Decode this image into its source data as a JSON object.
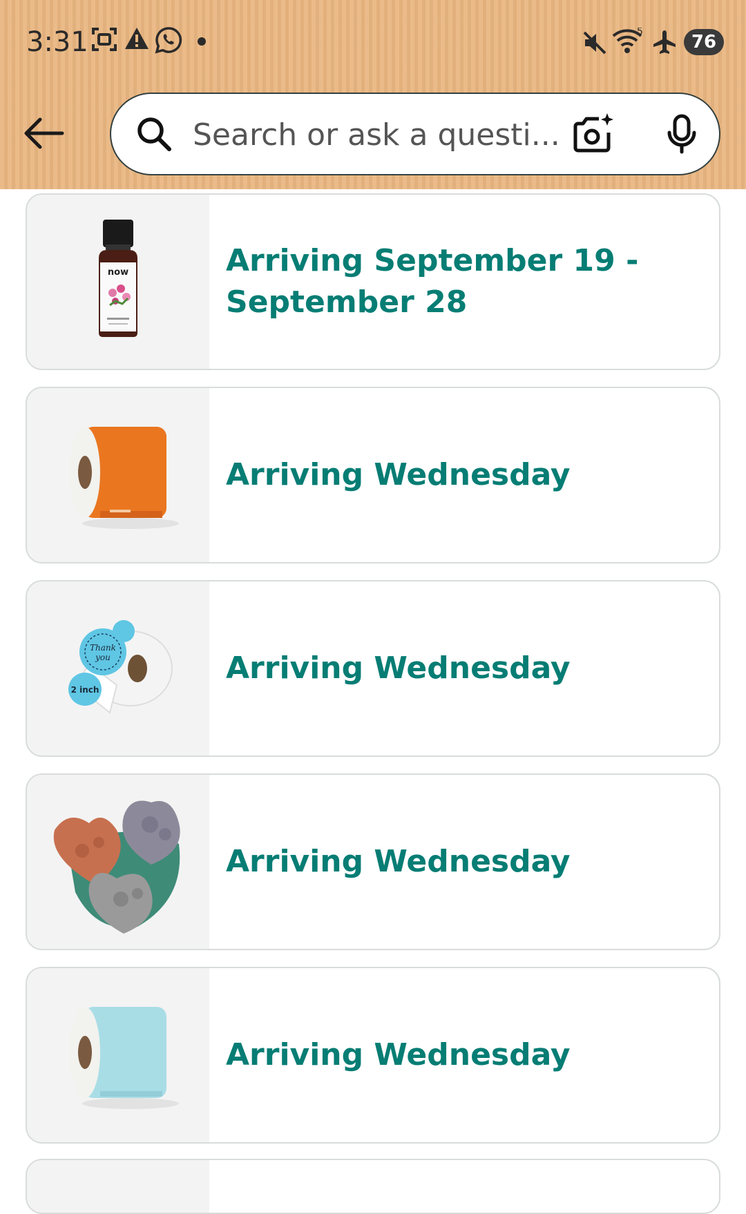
{
  "status_bar": {
    "time": "3:31",
    "battery": "76",
    "wifi_label": "5"
  },
  "search": {
    "placeholder": "Search or ask a questi..."
  },
  "orders": [
    {
      "arrival": "Arriving September 19 - September 28",
      "image": "geranium-essential-oil-bottle"
    },
    {
      "arrival": "Arriving Wednesday",
      "image": "orange-label-roll"
    },
    {
      "arrival": "Arriving Wednesday",
      "image": "thank-you-sticker-roll"
    },
    {
      "arrival": "Arriving Wednesday",
      "image": "heart-soap-mold"
    },
    {
      "arrival": "Arriving Wednesday",
      "image": "light-blue-label-roll"
    }
  ],
  "colors": {
    "header_bg": "#e9b680",
    "link_teal": "#067d74",
    "card_border": "#d9dcdc"
  }
}
